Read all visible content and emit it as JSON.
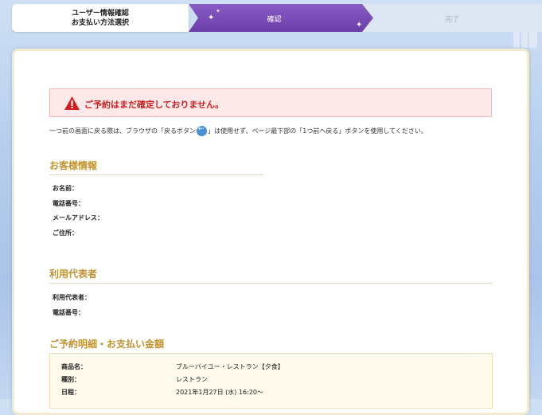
{
  "steps": [
    {
      "label_line1": "ユーザー情報確認",
      "label_line2": "お支払い方法選択"
    },
    {
      "label": "確認"
    },
    {
      "label": "完了"
    }
  ],
  "alert": {
    "message": "ご予約はまだ確定しておりません。"
  },
  "note": {
    "before": "一つ前の画面に戻る際は、ブラウザの「戻るボタン",
    "after": "」は使用せず、ページ最下部の「1つ前へ戻る」ボタンを使用してください。"
  },
  "customer": {
    "heading": "お客様情報",
    "labels": [
      "お名前：",
      "電話番号：",
      "メールアドレス：",
      "ご住所："
    ]
  },
  "representative": {
    "heading": "利用代表者",
    "labels": [
      "利用代表者：",
      "電話番号："
    ]
  },
  "reservation": {
    "heading": "ご予約明細・お支払い金額",
    "rows": [
      {
        "key": "商品名：",
        "value": "ブルーバイユー・レストラン【夕食】"
      },
      {
        "key": "種別：",
        "value": "レストラン"
      },
      {
        "key": "日程：",
        "value": "2021年1月27日 (水) 16:20〜"
      }
    ]
  },
  "colors": {
    "accent_gold": "#c0932f",
    "alert_red": "#d01f1f",
    "step_active": "#7a4cb6"
  }
}
